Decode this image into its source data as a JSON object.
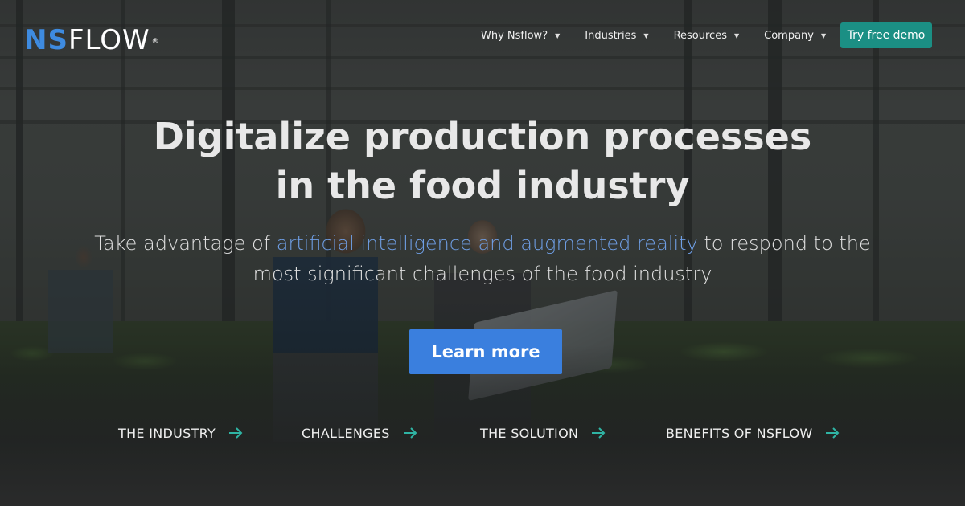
{
  "logo": {
    "part1": "NS",
    "part2": "FLOW",
    "reg": "®"
  },
  "nav": {
    "items": [
      {
        "label": "Why Nsflow?"
      },
      {
        "label": "Industries"
      },
      {
        "label": "Resources"
      },
      {
        "label": "Company"
      }
    ],
    "cta_label": "Try free demo"
  },
  "hero": {
    "title_line1": "Digitalize production processes",
    "title_line2": "in the food industry",
    "subtitle_pre": "Take advantage of ",
    "subtitle_highlight": "artificial intelligence and augmented reality",
    "subtitle_post": " to respond to the most significant challenges of the food industry",
    "button_label": "Learn more"
  },
  "sections": [
    {
      "label": "THE INDUSTRY"
    },
    {
      "label": "CHALLENGES"
    },
    {
      "label": "THE SOLUTION"
    },
    {
      "label": "BENEFITS OF NSFLOW"
    }
  ],
  "colors": {
    "brand_blue": "#3e8be0",
    "cta_teal": "#1b8f84",
    "button_blue": "#3a7fde",
    "highlight_text": "#6f9fe6",
    "arrow_teal": "#2fb4a4"
  },
  "icons": {
    "caret": "caret-down-icon",
    "arrow": "arrow-right-icon"
  }
}
